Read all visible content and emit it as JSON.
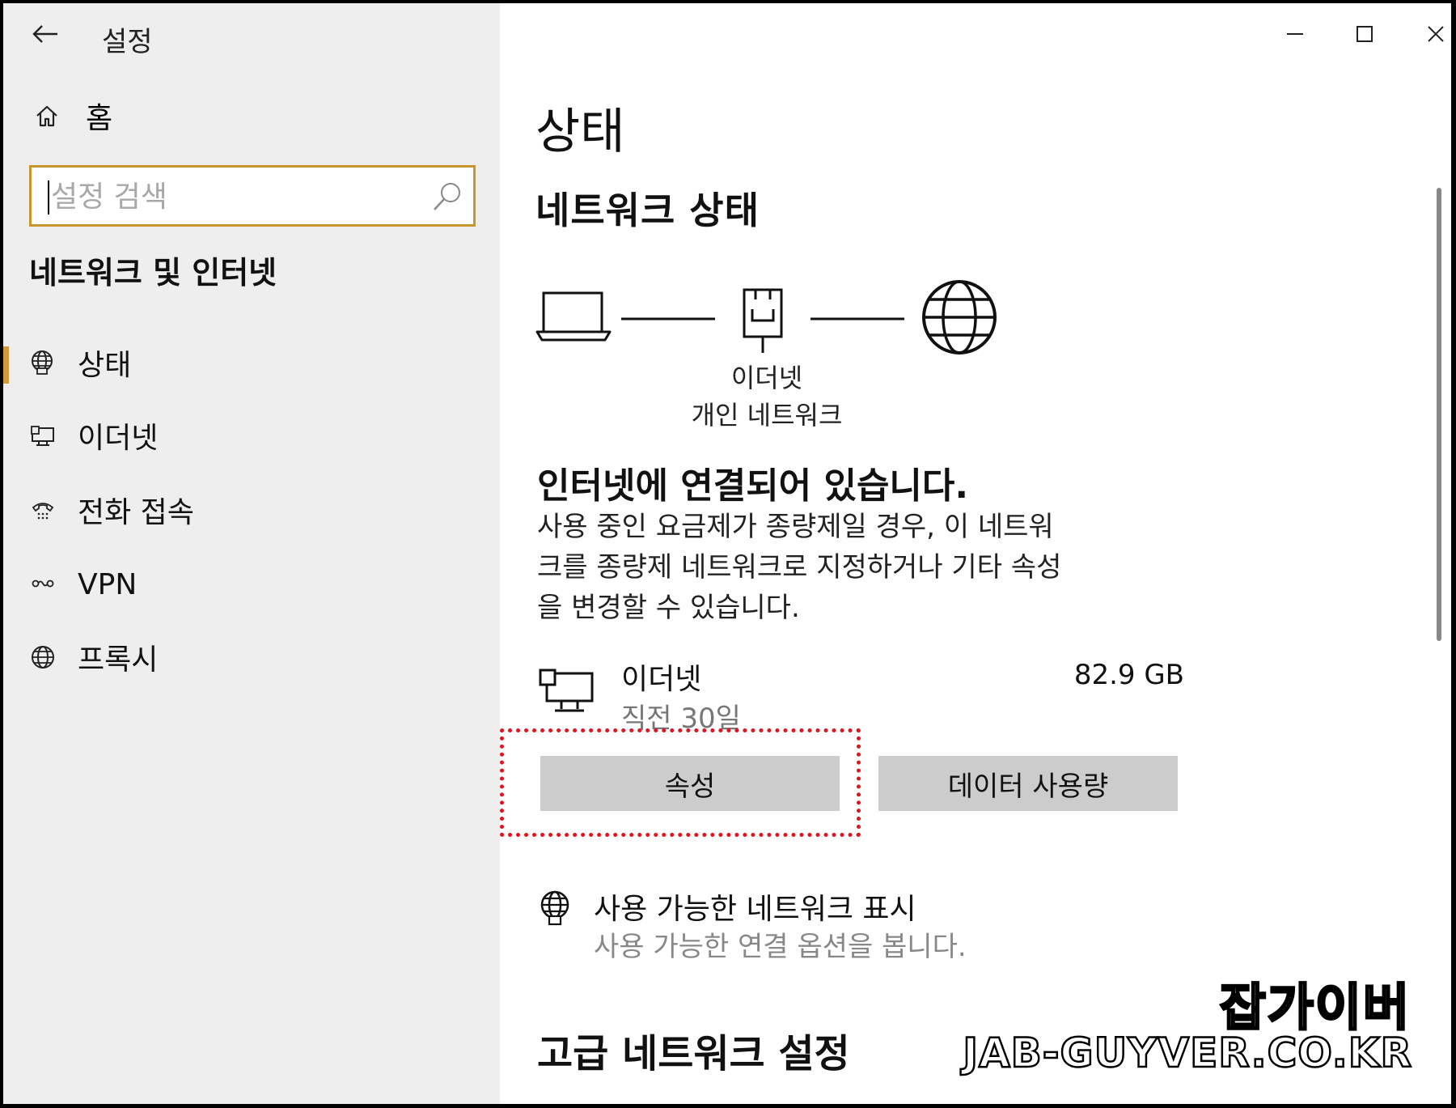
{
  "window": {
    "title": "설정",
    "controls": {
      "minimize_icon": "minimize-icon",
      "maximize_icon": "maximize-icon",
      "close_icon": "close-icon"
    }
  },
  "sidebar": {
    "home_label": "홈",
    "search": {
      "placeholder": "설정 검색",
      "value": ""
    },
    "section_title": "네트워크 및 인터넷",
    "items": [
      {
        "label": "상태",
        "icon": "status-globe-icon",
        "active": true
      },
      {
        "label": "이더넷",
        "icon": "ethernet-icon",
        "active": false
      },
      {
        "label": "전화 접속",
        "icon": "dialup-icon",
        "active": false
      },
      {
        "label": "VPN",
        "icon": "vpn-icon",
        "active": false
      },
      {
        "label": "프록시",
        "icon": "proxy-globe-icon",
        "active": false
      }
    ],
    "active_color": "#d09a3c"
  },
  "main": {
    "page_title": "상태",
    "network_status_heading": "네트워크 상태",
    "diagram": {
      "adapter_name": "이더넷",
      "network_type": "개인 네트워크"
    },
    "connected_heading": "인터넷에 연결되어 있습니다.",
    "connected_desc_lines": [
      "사용 중인 요금제가 종량제일 경우, 이 네트워",
      "크를 종량제 네트워크로 지정하거나 기타 속성",
      "을 변경할 수 있습니다."
    ],
    "connection": {
      "name": "이더넷",
      "period": "직전 30일",
      "usage": "82.9 GB"
    },
    "buttons": {
      "properties": "속성",
      "data_usage": "데이터 사용량"
    },
    "show_networks": {
      "title": "사용 가능한 네트워크 표시",
      "subtitle": "사용 가능한 연결 옵션을 봅니다."
    },
    "advanced_heading": "고급 네트워크 설정"
  },
  "watermark": {
    "ko": "잡가이버",
    "en": "JAB-GUYVER.CO.KR"
  },
  "colors": {
    "sidebar_bg": "#eeeeee",
    "search_border": "#c8962c",
    "button_bg": "#cccccc",
    "highlight": "#e0141e"
  }
}
